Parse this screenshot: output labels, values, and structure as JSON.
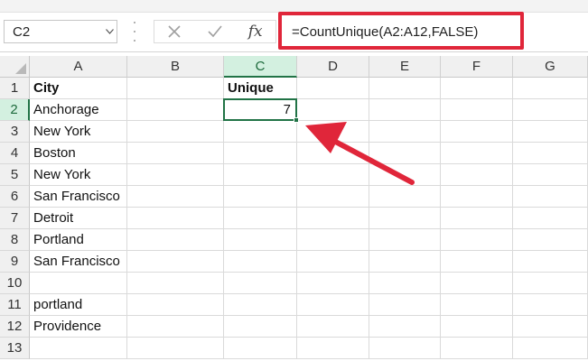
{
  "formula_bar": {
    "name_box": "C2",
    "formula": "=CountUnique(A2:A12,FALSE)",
    "fx_label": "fx"
  },
  "columns": [
    "A",
    "B",
    "C",
    "D",
    "E",
    "F",
    "G"
  ],
  "selected_column": "C",
  "rows": [
    "1",
    "2",
    "3",
    "4",
    "5",
    "6",
    "7",
    "8",
    "9",
    "10",
    "11",
    "12",
    "13"
  ],
  "selected_row": "2",
  "column_a": [
    "City",
    "Anchorage",
    "New York",
    "Boston",
    "New York",
    "San Francisco",
    "Detroit",
    "Portland",
    "San Francisco",
    "",
    "portland",
    "Providence",
    ""
  ],
  "column_c": {
    "header": "Unique",
    "value": "7"
  },
  "colors": {
    "accent": "#217346",
    "callout": "#e0263a"
  }
}
